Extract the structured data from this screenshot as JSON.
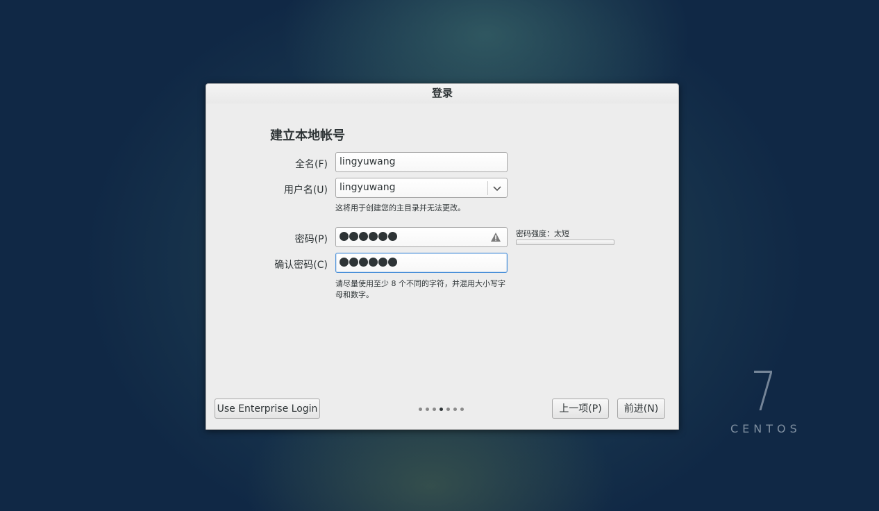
{
  "window": {
    "title": "登录"
  },
  "form": {
    "heading": "建立本地帐号",
    "fullname": {
      "label": "全名(F)",
      "value": "lingyuwang"
    },
    "username": {
      "label": "用户名(U)",
      "value": "lingyuwang",
      "hint": "这将用于创建您的主目录并无法更改。"
    },
    "password": {
      "label": "密码(P)",
      "masked_length": 6,
      "strength_label": "密码强度：太短",
      "strength": 0.0,
      "warning_icon": "warning-icon"
    },
    "confirm": {
      "label": "确认密码(C)",
      "masked_length": 6,
      "hint": "请尽量使用至少 8 个不同的字符，并混用大小写字母和数字。"
    }
  },
  "footer": {
    "enterprise_button": "Use Enterprise Login",
    "back_button": "上一项(P)",
    "next_button": "前进(N)",
    "pager": {
      "count": 7,
      "active_index": 3
    }
  },
  "branding": {
    "number": "7",
    "word": "CENTOS"
  },
  "colors": {
    "accent": "#4a90d9",
    "text": "#2e3436",
    "dialog_bg": "#ededed",
    "weak": "#cc0000"
  }
}
